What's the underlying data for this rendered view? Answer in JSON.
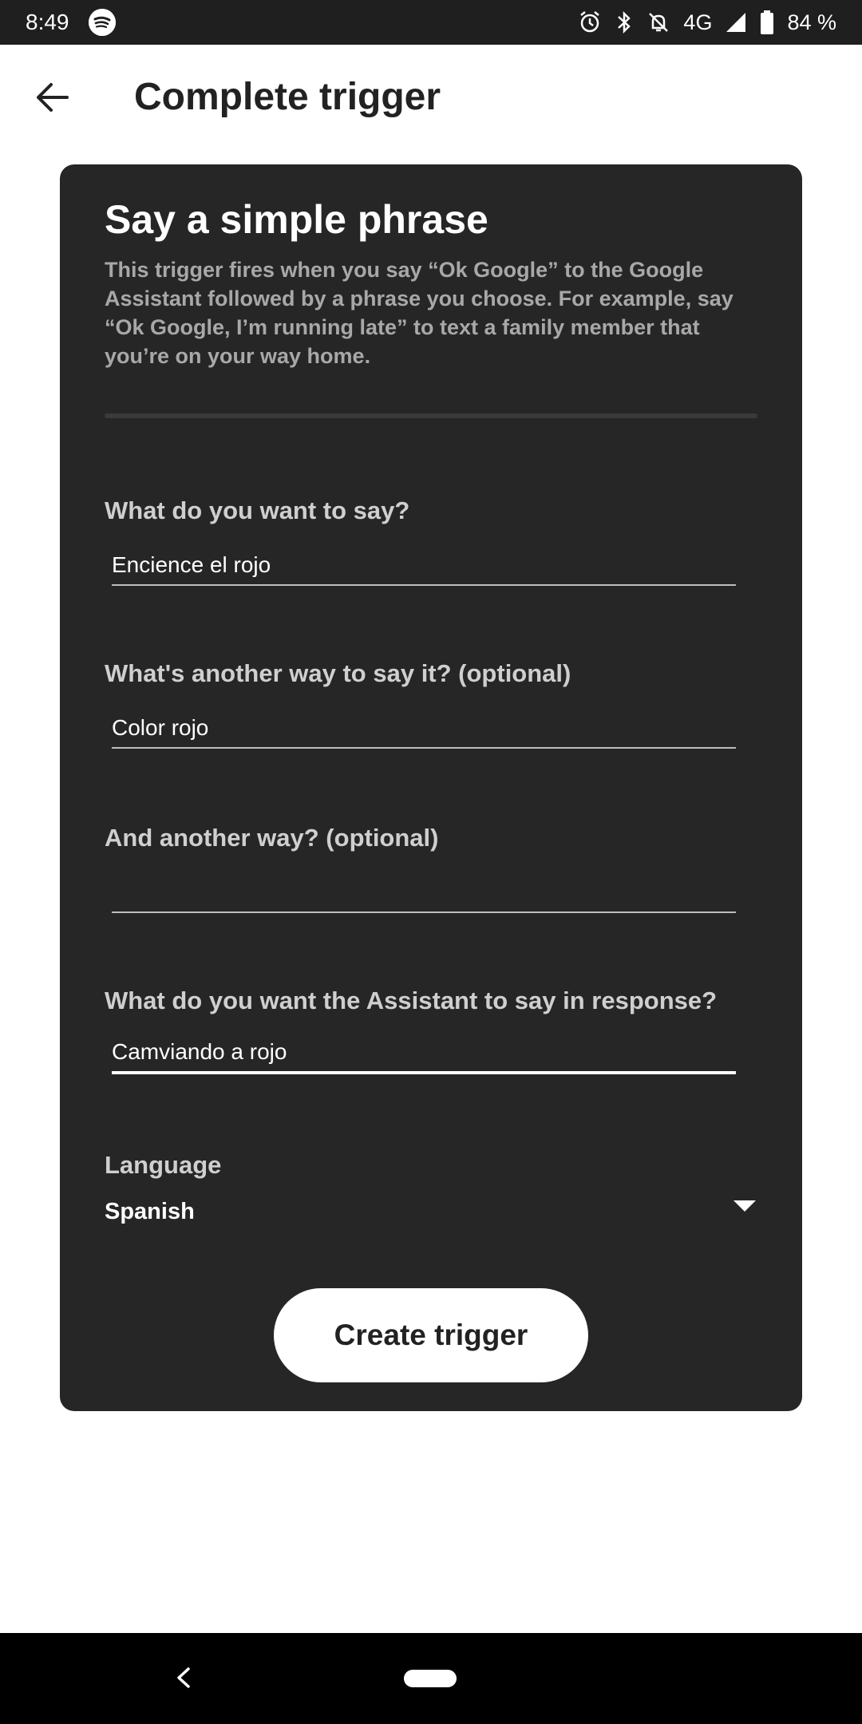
{
  "status_bar": {
    "time": "8:49",
    "network": "4G",
    "battery": "84 %",
    "icons": [
      "spotify-icon",
      "alarm-icon",
      "bluetooth-icon",
      "notifications-off-icon",
      "signal-icon",
      "battery-icon"
    ]
  },
  "header": {
    "title": "Complete trigger",
    "back_icon": "arrow-left-icon"
  },
  "card": {
    "title": "Say a simple phrase",
    "description": "This trigger fires when you say “Ok Google” to the Google Assistant followed by a phrase you choose. For example, say “Ok Google, I’m running late” to text a family member that you’re on your way home.",
    "fields": [
      {
        "label": "What do you want to say?",
        "value": "Encience el rojo"
      },
      {
        "label": "What's another way to say it? (optional)",
        "value": "Color rojo"
      },
      {
        "label": "And another way? (optional)",
        "value": ""
      },
      {
        "label": "What do you want the Assistant to say in response?",
        "value": "Camviando a rojo"
      }
    ],
    "language": {
      "label": "Language",
      "value": "Spanish"
    },
    "create_button": "Create trigger"
  },
  "colors": {
    "card_background": "#262626",
    "button_background": "#ffffff",
    "status_bar": "#1f1f1f"
  }
}
